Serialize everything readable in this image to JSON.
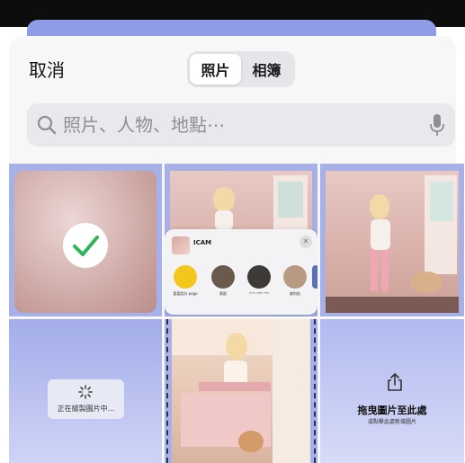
{
  "header": {
    "cancel_label": "取消",
    "tabs": [
      {
        "label": "照片",
        "active": true
      },
      {
        "label": "相簿",
        "active": false
      }
    ]
  },
  "search": {
    "placeholder": "照片、人物、地點⋯"
  },
  "share_popup": {
    "app_name": "ICAM",
    "contacts": [
      "喜喜設計 pego",
      "蔡凱",
      "ᴿᴼˢᴱ ᴾᴬᴿᴷ ᴱᴺᴳ",
      "謝利佑"
    ]
  },
  "grid": {
    "loading_text": "正在繪製圖片中...",
    "drop_title": "拖曳圖片至此處",
    "drop_subtitle": "或點擊此處新增圖片"
  },
  "colors": {
    "accent_check": "#2fb45a",
    "tile_blue": "#a7b1e8"
  }
}
